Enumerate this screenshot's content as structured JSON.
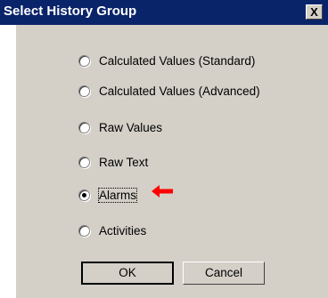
{
  "dialog": {
    "title": "Select History Group",
    "close_label": "X"
  },
  "options": [
    {
      "label": "Calculated Values (Standard)",
      "selected": false
    },
    {
      "label": "Calculated Values (Advanced)",
      "selected": false
    },
    {
      "label": "Raw Values",
      "selected": false
    },
    {
      "label": "Raw Text",
      "selected": false
    },
    {
      "label": "Alarms",
      "selected": true
    },
    {
      "label": "Activities",
      "selected": false
    }
  ],
  "buttons": {
    "ok_label": "OK",
    "cancel_label": "Cancel"
  },
  "annotation": {
    "icon": "red-arrow-icon",
    "color": "#ff0000"
  },
  "colors": {
    "titlebar": "#0a246a",
    "dialog_bg": "#d4d0c8"
  }
}
